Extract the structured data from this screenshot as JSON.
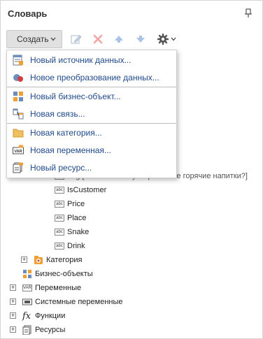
{
  "panel": {
    "title": "Словарь"
  },
  "toolbar": {
    "create_label": "Создать"
  },
  "menu": {
    "items": [
      {
        "label": "Новый источник данных...",
        "icon": "datasource-icon"
      },
      {
        "label": "Новое преобразование данных...",
        "icon": "transformation-icon"
      },
      {
        "label": "Новый бизнес-объект...",
        "icon": "business-object-icon"
      },
      {
        "label": "Новая связь...",
        "icon": "relation-icon"
      },
      {
        "label": "Новая категория...",
        "icon": "folder-icon"
      },
      {
        "label": "Новая переменная...",
        "icon": "variable-icon"
      },
      {
        "label": "Новый ресурс...",
        "icon": "resource-icon"
      }
    ]
  },
  "tree": {
    "partial_row": "Log [Как часто вы употребляете горячие напитки?]",
    "columns": [
      "IsCustomer",
      "Price",
      "Place",
      "Snake",
      "Drink"
    ],
    "category": "Категория",
    "business_objects": "Бизнес-объекты",
    "variables": "Переменные",
    "system_variables": "Системные переменные",
    "functions": "Функции",
    "resources": "Ресурсы",
    "abc": "abc",
    "var": "VAR",
    "fx": "fx"
  },
  "colors": {
    "menu_text": "#1f4a8a",
    "button_bg": "#e1e1e1",
    "separator": "#bdbdbd"
  }
}
